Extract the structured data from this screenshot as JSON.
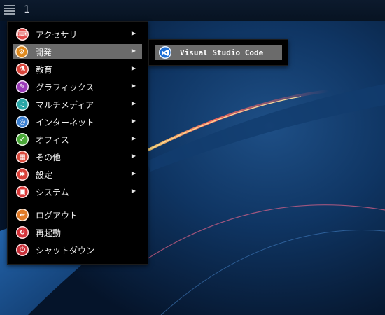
{
  "taskbar": {
    "workspace": "1"
  },
  "menu": {
    "items": [
      {
        "label": "アクセサリ",
        "icon": "accessories-icon",
        "color": "#e24b4b",
        "glyph": "⌨",
        "submenu": true
      },
      {
        "label": "開発",
        "icon": "development-icon",
        "color": "#e08a1e",
        "glyph": "⚙",
        "submenu": true,
        "active": true
      },
      {
        "label": "教育",
        "icon": "education-icon",
        "color": "#d9443a",
        "glyph": "⚗",
        "submenu": true
      },
      {
        "label": "グラフィックス",
        "icon": "graphics-icon",
        "color": "#9b3bb8",
        "glyph": "✎",
        "submenu": true
      },
      {
        "label": "マルチメディア",
        "icon": "multimedia-icon",
        "color": "#2aa6a6",
        "glyph": "♫",
        "submenu": true
      },
      {
        "label": "インターネット",
        "icon": "internet-icon",
        "color": "#3a7fd1",
        "glyph": "◎",
        "submenu": true
      },
      {
        "label": "オフィス",
        "icon": "office-icon",
        "color": "#4aa838",
        "glyph": "✓",
        "submenu": true
      },
      {
        "label": "その他",
        "icon": "other-icon",
        "color": "#d94a3d",
        "glyph": "▦",
        "submenu": true
      },
      {
        "label": "設定",
        "icon": "settings-icon",
        "color": "#d9413a",
        "glyph": "✱",
        "submenu": true
      },
      {
        "label": "システム",
        "icon": "system-icon",
        "color": "#d93a3a",
        "glyph": "▣",
        "submenu": true
      },
      {
        "label": "ログアウト",
        "icon": "logout-icon",
        "color": "#e07b28",
        "glyph": "↩",
        "submenu": false
      },
      {
        "label": "再起動",
        "icon": "restart-icon",
        "color": "#d4343b",
        "glyph": "↻",
        "submenu": false
      },
      {
        "label": "シャットダウン",
        "icon": "shutdown-icon",
        "color": "#c9303a",
        "glyph": "⏻",
        "submenu": false
      }
    ],
    "arrow_glyph": "▶"
  },
  "submenu": {
    "items": [
      {
        "label": "Visual Studio Code",
        "icon": "vscode-icon",
        "color": "#1e6fd6"
      }
    ]
  }
}
